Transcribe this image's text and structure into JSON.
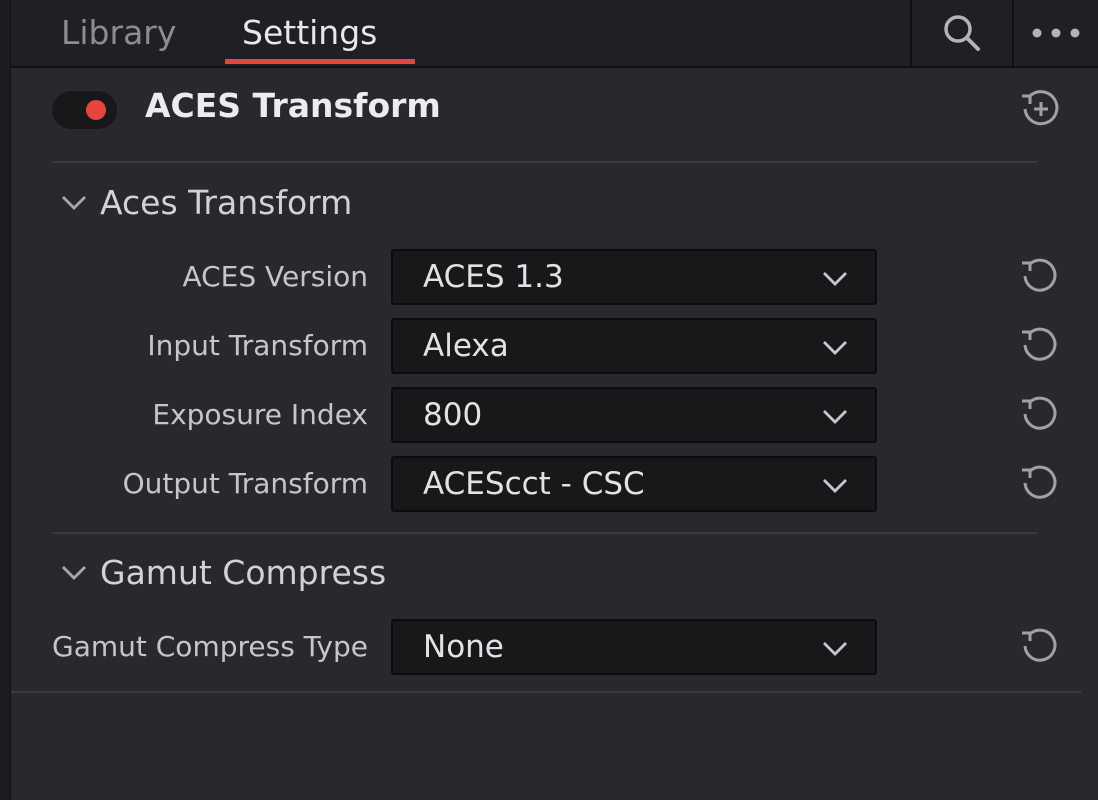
{
  "tabs": [
    {
      "label": "Library",
      "active": false
    },
    {
      "label": "Settings",
      "active": true
    }
  ],
  "accent_color": "#e8463c",
  "icons": {
    "search": "search-icon",
    "more": "more-horizontal-icon",
    "header_reset": "reset-add-icon",
    "row_reset": "reset-icon",
    "section_chevron": "chevron-down-icon",
    "dropdown_chevron": "chevron-down-icon"
  },
  "node": {
    "enabled": true,
    "title": "ACES Transform"
  },
  "sections": [
    {
      "title": "Aces Transform",
      "expanded": true,
      "fields": [
        {
          "label": "ACES Version",
          "value": "ACES 1.3"
        },
        {
          "label": "Input Transform",
          "value": "Alexa"
        },
        {
          "label": "Exposure Index",
          "value": "800"
        },
        {
          "label": "Output Transform",
          "value": "ACEScct - CSC"
        }
      ]
    },
    {
      "title": "Gamut Compress",
      "expanded": true,
      "fields": [
        {
          "label": "Gamut Compress Type",
          "value": "None"
        }
      ]
    }
  ]
}
